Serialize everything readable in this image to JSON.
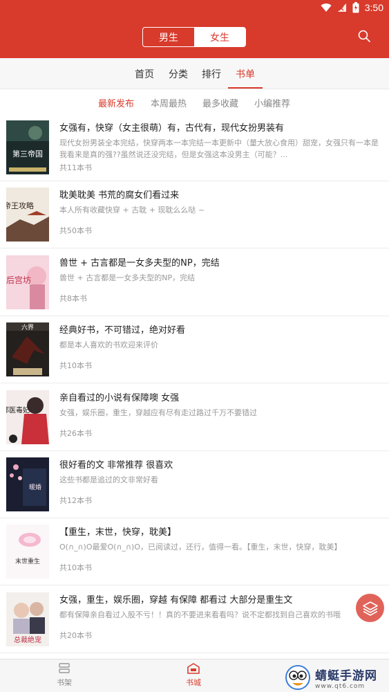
{
  "status_bar": {
    "time": "3:50"
  },
  "header": {
    "segment": {
      "male": "男生",
      "female": "女生"
    }
  },
  "tabs": [
    "首页",
    "分类",
    "排行",
    "书单"
  ],
  "subtabs": [
    "最新发布",
    "本周最热",
    "最多收藏",
    "小编推荐"
  ],
  "book_lists": [
    {
      "title": "女强有，快穿（女主很萌）有，古代有，现代女扮男装有",
      "desc": "现代女扮男装全本完结，快穿两本一本完结一本更新中（量大放心食用）甜宠，女强只有一本是我看来是真的强??虽然说还没完结，但是女强这本没男主（可能？...",
      "count": "共11本书",
      "cover_text": "第三帝国"
    },
    {
      "title": "耽美耽美 书荒的腐女们看过来",
      "desc": "本人所有收藏快穿 + 古耽 + 现耽么么哒 ~",
      "count": "共50本书",
      "cover_text": "帝王攻略"
    },
    {
      "title": "兽世 + 古言都是一女多夫型的NP，完结",
      "desc": "兽世 + 古言都是一女多夫型的NP，完结",
      "count": "共8本书",
      "cover_text": "后宫坊"
    },
    {
      "title": "经典好书，不可错过，绝对好看",
      "desc": "都是本人喜欢的书欢迎来评价",
      "count": "共10本书",
      "cover_text": "六界"
    },
    {
      "title": "亲自看过的小说有保障噢 女强",
      "desc": "女强，娱乐圈，重生，穿越应有尽有走过路过千万不要错过",
      "count": "共26本书",
      "cover_text": "邪医毒妃"
    },
    {
      "title": "很好看的文 非常推荐 很喜欢",
      "desc": "这些书都是追过的文非常好看",
      "count": "共12本书",
      "cover_text": "暖婚"
    },
    {
      "title": "【重生，末世，快穿，耽美】",
      "desc": "O(∩_∩)O最爱O(∩_∩)O，已阅读过，还行，值得一看。【重生，末世，快穿，耽美】",
      "count": "共10本书",
      "cover_text": "末世重生"
    },
    {
      "title": "女强，重生，娱乐圈，穿越 有保障 都看过 大部分是重生文",
      "desc": "都有保障亲自看过入股不亏！！真的不要进来看看吗？说不定都找到自己喜欢的书哦",
      "count": "共20本书",
      "cover_text": "总裁绝宠"
    }
  ],
  "bottom_nav": {
    "shelf": "书架",
    "store": "书城"
  },
  "watermark": {
    "title": "蜻蜓手游网",
    "url": "www.qt6.com"
  },
  "colors": {
    "accent": "#d83a2c",
    "fab": "#e0635a"
  }
}
